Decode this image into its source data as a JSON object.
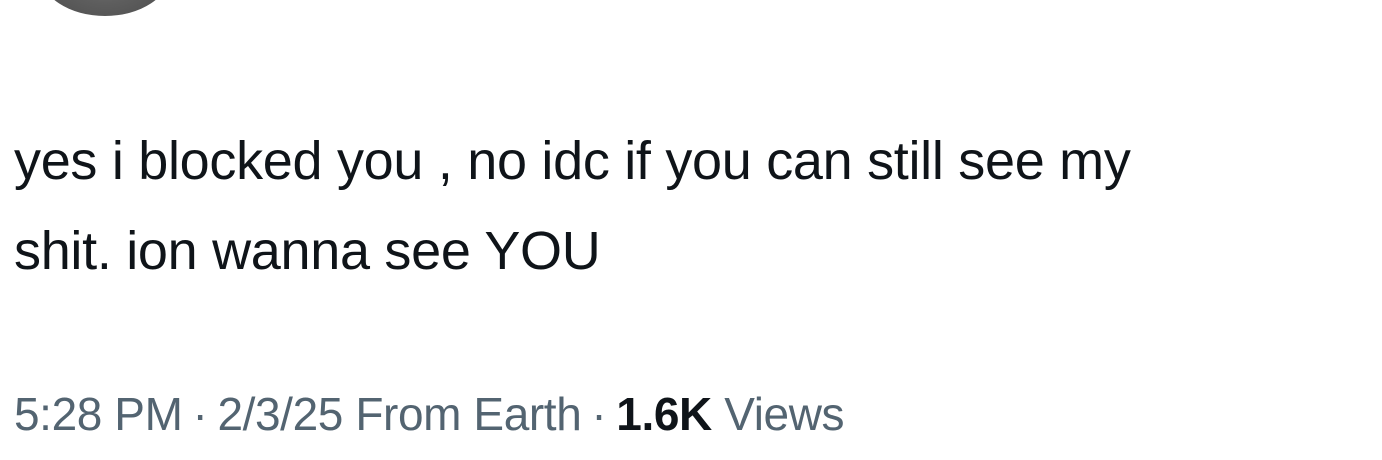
{
  "tweet": {
    "text_lines": [
      "yes i blocked you , no idc if you can still see my",
      "shit. ion wanna see YOU"
    ]
  },
  "meta": {
    "time": "5:28 PM",
    "separator": "·",
    "date": "2/3/25",
    "location": "From Earth",
    "views_count": "1.6K",
    "views_label": "Views"
  },
  "colors": {
    "text": "#0f1419",
    "secondary": "#536471",
    "background": "#ffffff"
  }
}
